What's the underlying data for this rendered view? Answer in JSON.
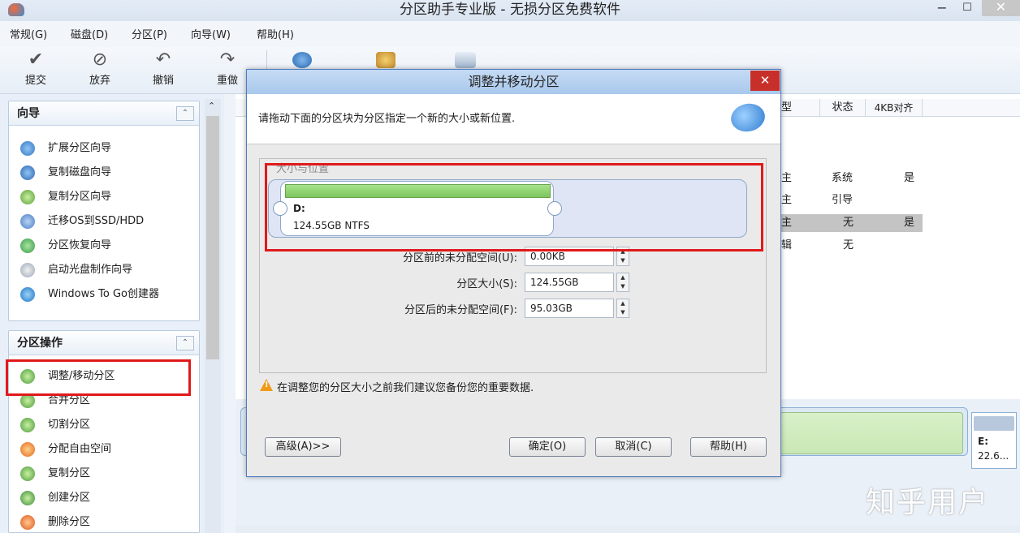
{
  "window": {
    "title": "分区助手专业版 - 无损分区免费软件",
    "minimize_glyph": "−",
    "maximize_glyph": "☐",
    "close_glyph": "✕"
  },
  "menu": [
    "常规(G)",
    "磁盘(D)",
    "分区(P)",
    "向导(W)",
    "帮助(H)"
  ],
  "toolbar": {
    "commit": "提交",
    "discard": "放弃",
    "undo": "撤销",
    "redo": "重做"
  },
  "wizard_panel": {
    "title": "向导",
    "items": [
      "扩展分区向导",
      "复制磁盘向导",
      "复制分区向导",
      "迁移OS到SSD/HDD",
      "分区恢复向导",
      "启动光盘制作向导",
      "Windows To Go创建器"
    ]
  },
  "ops_panel": {
    "title": "分区操作",
    "items": [
      "调整/移动分区",
      "合并分区",
      "切割分区",
      "分配自由空间",
      "复制分区",
      "创建分区",
      "删除分区"
    ]
  },
  "table": {
    "headers": [
      "型",
      "状态",
      "4KB对齐"
    ],
    "rows": [
      {
        "type": "主",
        "status": "系统",
        "align": "是"
      },
      {
        "type": "主",
        "status": "引导",
        "align": ""
      },
      {
        "type": "主",
        "status": "无",
        "align": "是"
      },
      {
        "type": "辑",
        "status": "无",
        "align": ""
      }
    ]
  },
  "disk_map": {
    "e_label": "E:",
    "e_size": "22.6..."
  },
  "dialog": {
    "title": "调整并移动分区",
    "close_glyph": "✕",
    "instruction": "请拖动下面的分区块为分区指定一个新的大小或新位置.",
    "group_label": "大小与位置",
    "partition_name": "D:",
    "partition_info": "124.55GB NTFS",
    "fields": {
      "before_label": "分区前的未分配空间(U):",
      "before_value": "0.00KB",
      "size_label": "分区大小(S):",
      "size_value": "124.55GB",
      "after_label": "分区后的未分配空间(F):",
      "after_value": "95.03GB"
    },
    "warning": "在调整您的分区大小之前我们建议您备份您的重要数据.",
    "buttons": {
      "advanced": "高级(A)>>",
      "ok": "确定(O)",
      "cancel": "取消(C)",
      "help": "帮助(H)"
    }
  },
  "watermark": "知乎用户",
  "colors": {
    "highlight_red": "#e0191b",
    "partition_green": "#7cc65c",
    "dialog_close": "#c7302a"
  }
}
